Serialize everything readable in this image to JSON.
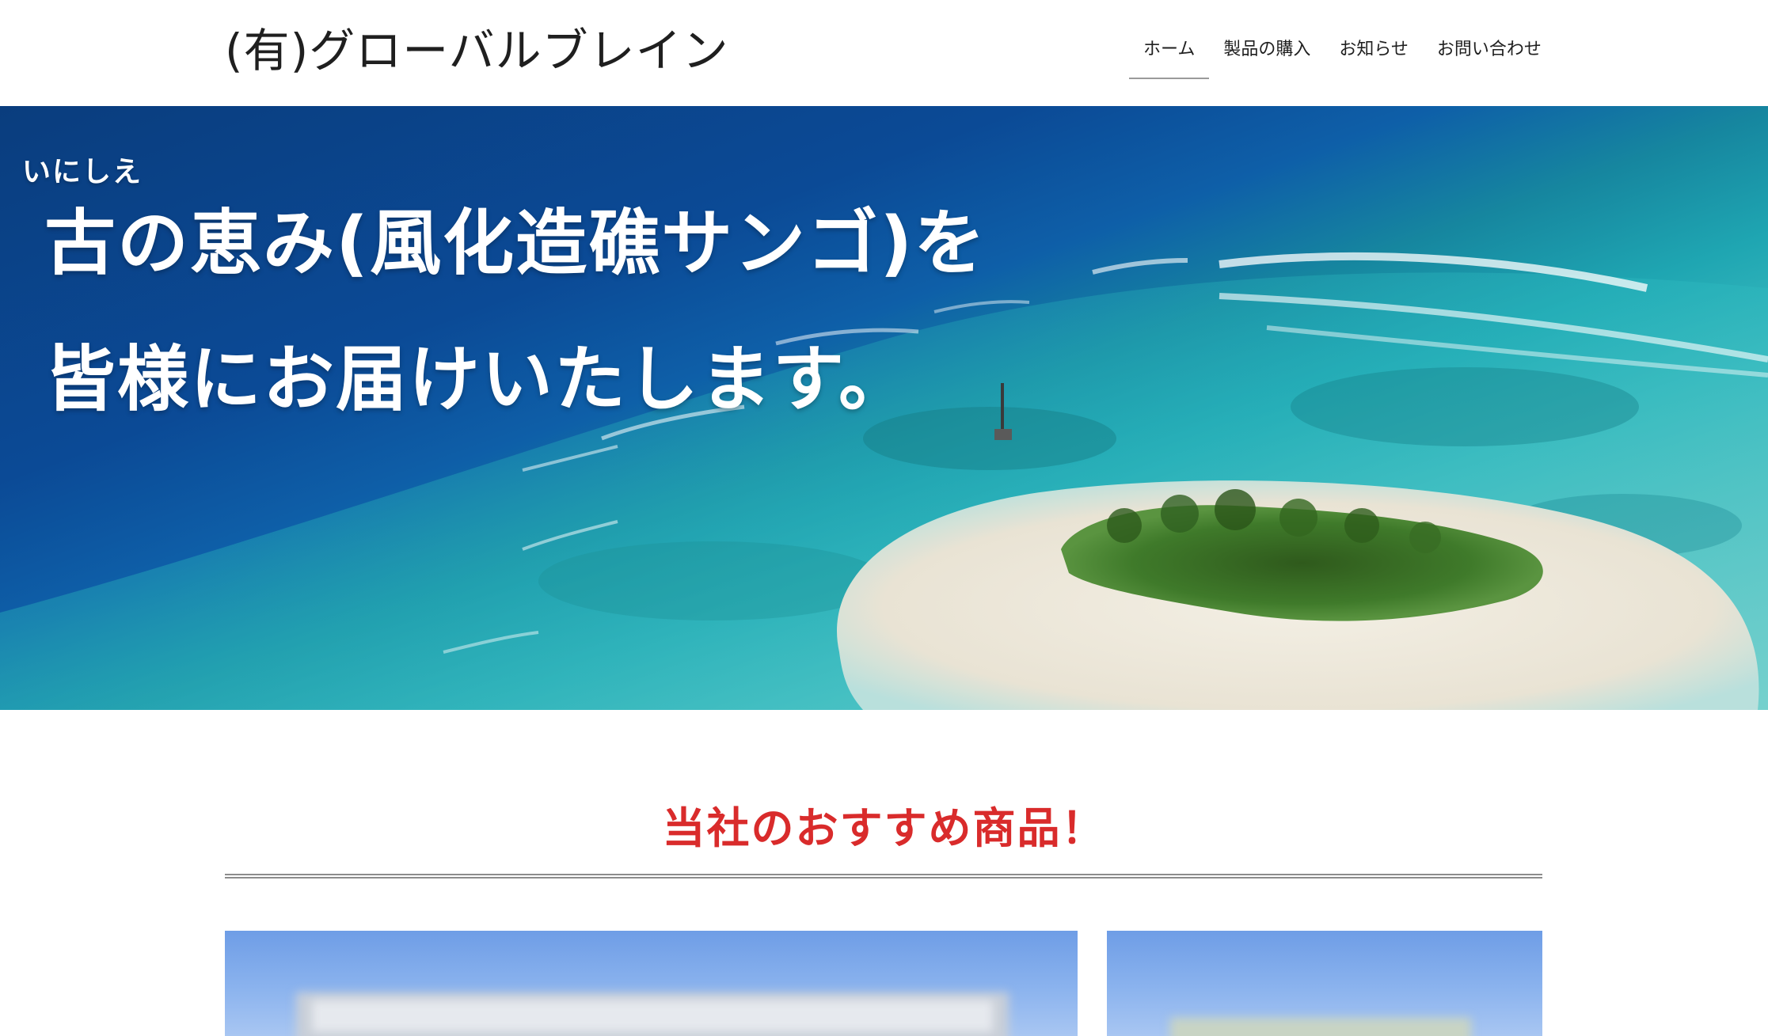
{
  "header": {
    "site_title": "(有)グローバルブレイン",
    "nav": [
      {
        "label": "ホーム",
        "active": true
      },
      {
        "label": "製品の購入",
        "active": false
      },
      {
        "label": "お知らせ",
        "active": false
      },
      {
        "label": "お問い合わせ",
        "active": false
      }
    ]
  },
  "hero": {
    "ruby": "いにしえ",
    "line1": "古の恵み(風化造礁サンゴ)を",
    "line2": "皆様にお届けいたします。"
  },
  "section": {
    "title": "当社のおすすめ商品！"
  },
  "colors": {
    "section_title": "#d92b2b",
    "nav_active_underline": "#9a9a9a",
    "card_sky": "#7ea9ea"
  }
}
